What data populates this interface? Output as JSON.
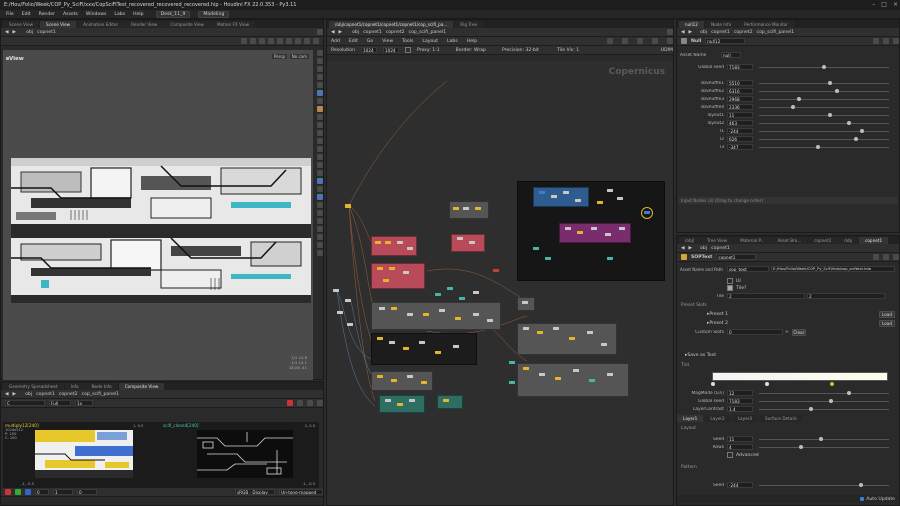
{
  "window": {
    "title": "E:/Hou/Folio/Week/COP_Py_SciFi/xxx/CopSciFiTest_recovered_recovered_recovered.hip - Houdini FX 22.0.353 - Py3.11",
    "menus": [
      "File",
      "Edit",
      "Render",
      "Assets",
      "Windows",
      "Labs",
      "Help"
    ],
    "desk": "Desk_11_9",
    "modeling": "Modeling"
  },
  "left_top_tabs": [
    "Scene View",
    "Scene View",
    "Animation Editor",
    "Render View",
    "Composite View",
    "Motion FX View"
  ],
  "viewport": {
    "path": [
      "obj",
      "copnet1"
    ],
    "label": "View",
    "corner_buttons": [
      "Persp",
      "No cam"
    ],
    "overlay_text": [
      "1/1 10.8",
      "1/1 10.1",
      "18.06 .41"
    ]
  },
  "left_bottom_tabs": [
    "Geometry Spreadsheet",
    "Info",
    "Node Info",
    "Composite View"
  ],
  "comp": {
    "path": [
      "obj",
      "copnet1",
      "copnet2",
      "cop_scifi_panel1"
    ],
    "controls": [
      "Full",
      "1x",
      "0",
      "1",
      "0"
    ],
    "left_label": "multiply12[240]",
    "left_sub": [
      "1024x512",
      "P: 200",
      "C: 100"
    ],
    "right_label": "scifi_clone4[240]",
    "corner_tl": "1, 0.5",
    "corner_br": "-1, -0.5",
    "bottom": [
      "sRGB - Display",
      "Un-tone-mapped"
    ]
  },
  "center_tabs": [
    "/obj/copnet1/copnet1/copnet1/copnet1/cop_scifi_pa...",
    "Rig Tree"
  ],
  "network": {
    "path": [
      "obj",
      "copnet1",
      "copnet2",
      "cop_scifi_panel1"
    ],
    "menus": [
      "Add",
      "Edit",
      "Go",
      "View",
      "Tools",
      "Layout",
      "Labs",
      "Help"
    ],
    "resolution_label": "Resolution",
    "res": [
      "1024",
      "1024"
    ],
    "proxy": "Proxy: 1:1",
    "border": "Border: Wrap",
    "precision": "Precision: 32-bit",
    "tile": "Tile Vis: 1",
    "udim": "UDIM",
    "watermark": "Copernicus"
  },
  "rt_tabs": [
    "null12",
    "Node Info",
    "Performance Monitor"
  ],
  "rt_panel": {
    "path": [
      "obj",
      "copnet1",
      "copnet2",
      "cop_scifi_panel1"
    ],
    "node_type": "Null",
    "node_name": "null12",
    "asset_label": "Asset Name",
    "asset_value": "null",
    "params": [
      {
        "label": "Global seed",
        "value": "7183",
        "pos": 0.5
      },
      {
        "label": "sbShuffle1",
        "value": "5510",
        "pos": 0.55
      },
      {
        "label": "sbShuffle2",
        "value": "6316",
        "pos": 0.6
      },
      {
        "label": "sbShuffle3",
        "value": "2968",
        "pos": 0.3
      },
      {
        "label": "sbShuffle4",
        "value": "2336",
        "pos": 0.25
      },
      {
        "label": "layout1",
        "value": "11",
        "pos": 0.55
      },
      {
        "label": "layout2",
        "value": "463",
        "pos": 0.7
      },
      {
        "label": "l1",
        "value": "-244",
        "pos": 0.8
      },
      {
        "label": "l2",
        "value": "626",
        "pos": 0.75
      },
      {
        "label": "l3",
        "value": "-347",
        "pos": 0.45
      }
    ],
    "footer": "Input Nodes (3) (Drag to change order)"
  },
  "rb_tabs": [
    "/obj/",
    "Tree View",
    "Material P...",
    "Asset Bro...",
    "copnet2",
    "/obj",
    "copnet1"
  ],
  "rb_panel": {
    "path": [
      "obj",
      "copnet1"
    ],
    "node_type": "SOPText",
    "node_name": "copnet1",
    "asset_label": "Asset Name and Path",
    "asset_value": "sop_text",
    "asset_path": "E:/Hou/Folio/Week/COP_Py_SciFi/hda/sop_sciftext.hda",
    "checks": [
      "UI",
      "Tile?"
    ],
    "tile_label": "Tile",
    "tile_values": [
      "2",
      "2"
    ],
    "preset_slots_label": "Preset Slots",
    "presets": [
      "Preset 1",
      "Preset 2"
    ],
    "load_label": "Load",
    "custom_slots_label": "Custom Slots",
    "custom_slots_value": "0",
    "clear_label": "Clear",
    "save_label": "Save as Text",
    "tint_label": "Tint",
    "mag_label": "MagMode (Lin)",
    "mag_value": "12",
    "gseed_label": "Global seed",
    "gseed_value": "7183",
    "layercontrast_label": "LayerContrast",
    "layercontrast_value": "1.4",
    "layer_tabs": [
      "Layer1",
      "Layer2",
      "Layer3",
      "Surface Details"
    ],
    "layout_label": "Layout",
    "seed_label": "Seed",
    "seed_value": "11",
    "rows_label": "Rows",
    "rows_value": "4",
    "advanced_label": "Advanced",
    "pattern_label": "Pattern",
    "seed2_label": "Seed",
    "seed2_value": "-244",
    "autoupdate": "Auto Update"
  },
  "colors": {
    "yellow": "#e2b52a",
    "red_box": "#b84a5a",
    "purple_box": "#7a2c6c",
    "blue_box": "#2f5c8f",
    "grey_box": "#555555",
    "teal_box": "#2e6e62"
  }
}
